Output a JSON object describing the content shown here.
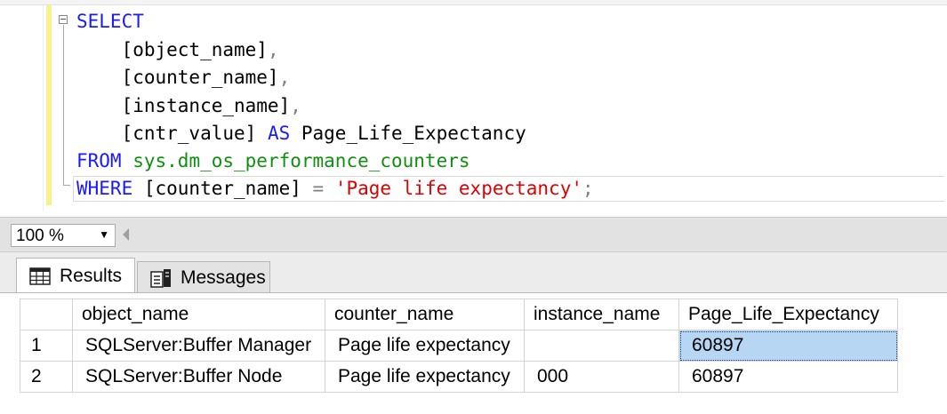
{
  "editor": {
    "lines": [
      {
        "parts": [
          {
            "cls": "kw",
            "text": "SELECT"
          }
        ]
      },
      {
        "parts": [
          {
            "cls": "",
            "text": "    [object_name]"
          },
          {
            "cls": "op",
            "text": ","
          }
        ]
      },
      {
        "parts": [
          {
            "cls": "",
            "text": "    [counter_name]"
          },
          {
            "cls": "op",
            "text": ","
          }
        ]
      },
      {
        "parts": [
          {
            "cls": "",
            "text": "    [instance_name]"
          },
          {
            "cls": "op",
            "text": ","
          }
        ]
      },
      {
        "parts": [
          {
            "cls": "",
            "text": "    [cntr_value] "
          },
          {
            "cls": "kw",
            "text": "AS"
          },
          {
            "cls": "",
            "text": " Page_Life_Expectancy"
          }
        ]
      },
      {
        "parts": [
          {
            "cls": "kw",
            "text": "FROM"
          },
          {
            "cls": "",
            "text": " "
          },
          {
            "cls": "sys",
            "text": "sys.dm_os_performance_counters"
          }
        ]
      },
      {
        "parts": [
          {
            "cls": "kw",
            "text": "WHERE"
          },
          {
            "cls": "",
            "text": " [counter_name] "
          },
          {
            "cls": "op",
            "text": "="
          },
          {
            "cls": "",
            "text": " "
          },
          {
            "cls": "str",
            "text": "'Page life expectancy'"
          },
          {
            "cls": "op",
            "text": ";"
          }
        ]
      }
    ]
  },
  "zoom": {
    "value": "100 %"
  },
  "tabs": {
    "results": {
      "label": "Results",
      "icon": "grid-icon"
    },
    "messages": {
      "label": "Messages",
      "icon": "messages-icon"
    }
  },
  "grid": {
    "columns": [
      "",
      "object_name",
      "counter_name",
      "instance_name",
      "Page_Life_Expectancy"
    ],
    "rows": [
      [
        "1",
        "SQLServer:Buffer Manager",
        "Page life expectancy",
        "",
        "60897"
      ],
      [
        "2",
        "SQLServer:Buffer Node",
        "Page life expectancy",
        "000",
        "60897"
      ]
    ]
  },
  "colors": {
    "keyword": "#1a1aff",
    "system_object": "#109010",
    "string": "#e00000",
    "selected_cell": "#b7d6f3"
  }
}
